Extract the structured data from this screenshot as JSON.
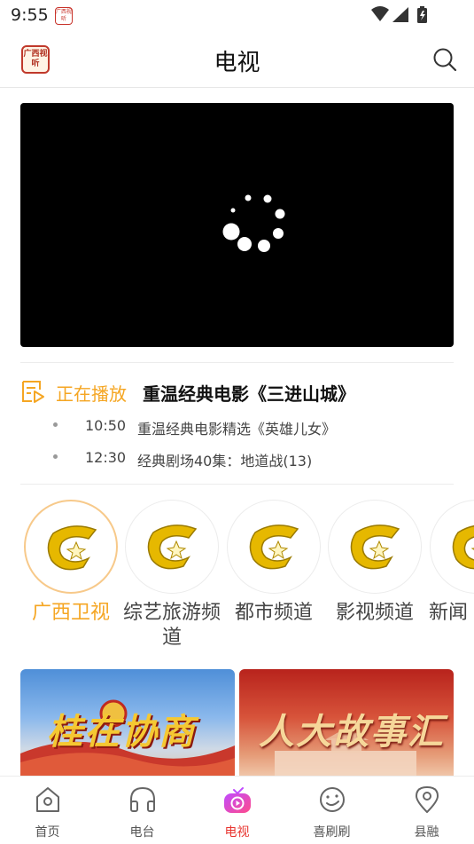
{
  "status_bar": {
    "time": "9:55",
    "app_icon_text": "广西视听"
  },
  "header": {
    "logo_text": "广西视听",
    "title": "电视",
    "search_icon": "search-icon"
  },
  "now_playing": {
    "label": "正在播放",
    "title": "重温经典电影《三进山城》"
  },
  "schedule": [
    {
      "time": "10:50",
      "name": "重温经典电影精选《英雄儿女》"
    },
    {
      "time": "12:30",
      "name": "经典剧场40集：地道战(13)"
    }
  ],
  "channels": [
    {
      "name": "广西卫视",
      "active": true
    },
    {
      "name": "综艺旅游频道",
      "active": false
    },
    {
      "name": "都市频道",
      "active": false
    },
    {
      "name": "影视频道",
      "active": false
    },
    {
      "name": "新闻",
      "active": false
    }
  ],
  "banners": [
    {
      "text": "桂在协商"
    },
    {
      "text": "人大故事汇"
    }
  ],
  "tabs": [
    {
      "label": "首页",
      "icon": "home-icon"
    },
    {
      "label": "电台",
      "icon": "headphones-icon"
    },
    {
      "label": "电视",
      "icon": "tv-play-icon"
    },
    {
      "label": "喜刷刷",
      "icon": "smile-icon"
    },
    {
      "label": "县融",
      "icon": "location-pin-icon"
    }
  ],
  "colors": {
    "accent": "#f5a623",
    "active_tab": "#e8342f",
    "video_bg": "#000000"
  }
}
